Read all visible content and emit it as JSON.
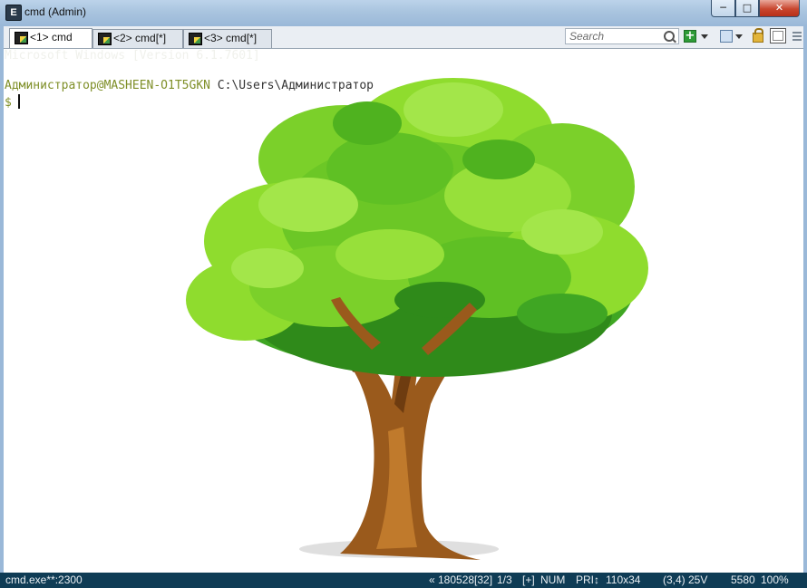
{
  "window": {
    "title": "cmd (Admin)",
    "minimize_glyph": "─",
    "maximize_glyph": "□",
    "close_glyph": "✕"
  },
  "tabs": [
    {
      "label": "<1> cmd",
      "active": true
    },
    {
      "label": "<2> cmd[*]",
      "active": false
    },
    {
      "label": "<3> cmd[*]",
      "active": false
    }
  ],
  "search": {
    "placeholder": "Search"
  },
  "toolbar": {
    "add_glyph": "+"
  },
  "console": {
    "banner": "Microsoft Windows [Version 6.1.7601]",
    "prompt_user": "Администратор@MASHEEN-O1T5GKN",
    "prompt_path": " C:\\Users\\Администратор",
    "prompt_symbol": "$"
  },
  "status": {
    "process": "cmd.exe**:2300",
    "position": "« 180528[32]",
    "pages": "1/3",
    "insert": "[+]",
    "numlock": "NUM",
    "priority": "PRI↕",
    "size": "110x34",
    "cursor": "(3,4) 25V",
    "pid": "5580",
    "zoom": "100%"
  },
  "colors": {
    "status_bg": "#0f3c55",
    "prompt_user": "#7f8f28",
    "leaf_light": "#8fdc2e",
    "leaf_mid": "#5fc024",
    "leaf_dark": "#2f8a1a",
    "trunk": "#9a5a1c"
  },
  "icons": [
    "app-icon",
    "console-tab-icon",
    "search-icon",
    "add-icon",
    "chevron-down-icon",
    "panel-icon",
    "lock-icon",
    "view-icon",
    "grip-icon"
  ]
}
